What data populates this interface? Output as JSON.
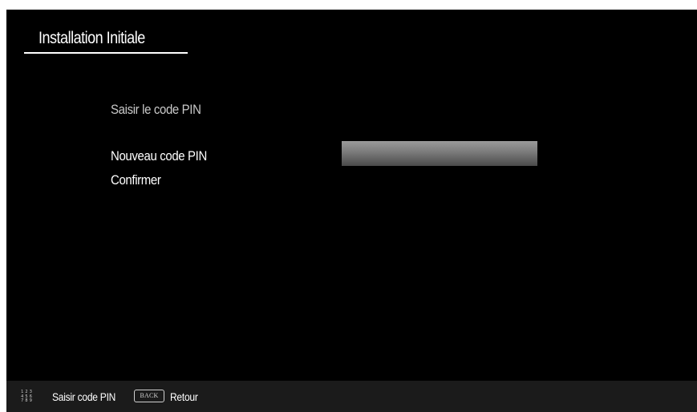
{
  "header": {
    "title": "Installation Initiale"
  },
  "pin_form": {
    "prompt": "Saisir le code PIN",
    "new_pin_label": "Nouveau code PIN",
    "confirm_label": "Confirmer",
    "new_pin_value": ""
  },
  "footer": {
    "numpad_digits": [
      "1",
      "2",
      "3",
      "4",
      "5",
      "6",
      "7",
      "8",
      "9"
    ],
    "enter_pin_hint": "Saisir code PIN",
    "back_key_label": "BACK",
    "back_hint": "Retour"
  },
  "colors": {
    "background": "#000000",
    "footer_background": "#1b1b1b",
    "text": "#ffffff",
    "prompt_text": "#c9c9c9",
    "input_highlight": "#8a8a8a"
  }
}
